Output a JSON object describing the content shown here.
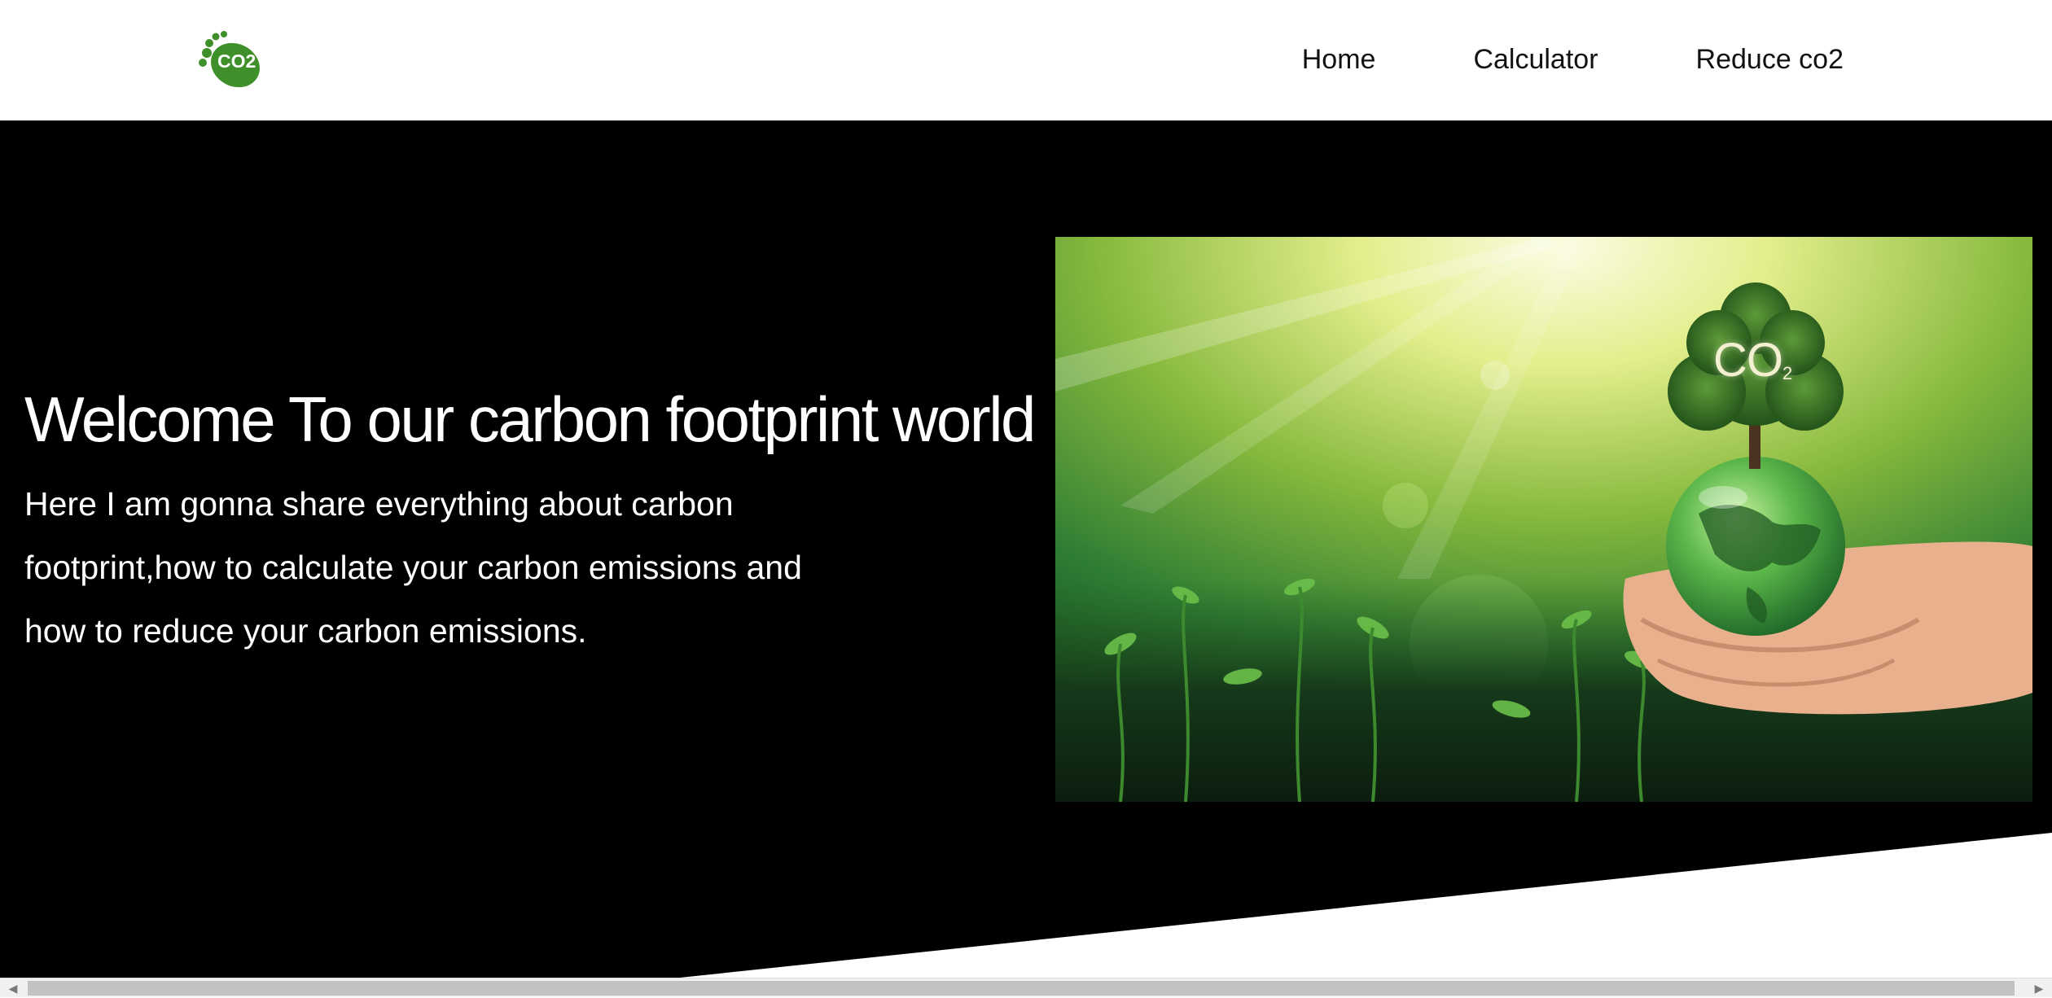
{
  "nav": {
    "logo_icon": "co2-footprint-logo-icon",
    "logo_text": "CO2",
    "links": [
      {
        "label": "Home"
      },
      {
        "label": "Calculator"
      },
      {
        "label": "Reduce co2"
      }
    ]
  },
  "hero": {
    "title": "Welcome To our carbon footprint world",
    "description": "Here I am gonna share everything about carbon footprint,how to calculate your carbon emissions and how to reduce your carbon emissions.",
    "image": {
      "subject": "hands holding glass globe with tree growing on top",
      "co2_label": "CO",
      "co2_sub": "2"
    }
  },
  "colors": {
    "hero_background": "#000000",
    "nav_background": "#ffffff",
    "logo_green": "#3f8f2a"
  },
  "scrollbar": {
    "left_arrow_icon": "scroll-left-arrow-icon",
    "right_arrow_icon": "scroll-right-arrow-icon"
  }
}
